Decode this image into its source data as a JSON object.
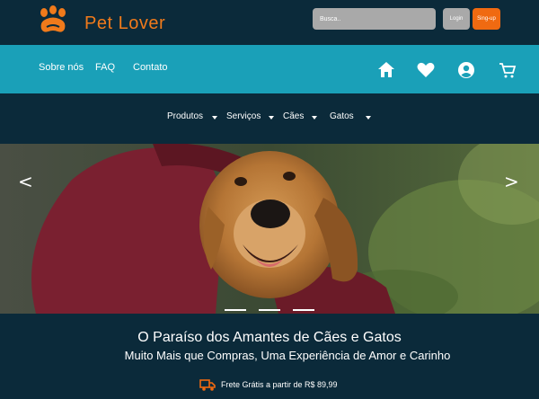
{
  "header": {
    "brand": "Pet Lover",
    "search_placeholder": "Busca..",
    "login_label": "Login",
    "signup_label": "Sing-up",
    "accent_color": "#f06a11"
  },
  "top_nav": {
    "links": [
      "Sobre nós",
      "FAQ",
      "Contato"
    ],
    "icons": [
      "home-icon",
      "heart-icon",
      "user-icon",
      "cart-icon"
    ],
    "background": "#1aa0b8"
  },
  "category_nav": {
    "items": [
      "Produtos",
      "Serviços",
      "Cães",
      "Gatos"
    ]
  },
  "hero": {
    "prev_arrow": "<",
    "next_arrow": ">",
    "slide_count": 3
  },
  "banner": {
    "title": "O Paraíso dos Amantes de Cães e Gatos",
    "subtitle": "Muito Mais que Compras, Uma Experiência de Amor e Carinho",
    "shipping": "Frete Grátis a partir de R$ 89,99"
  }
}
